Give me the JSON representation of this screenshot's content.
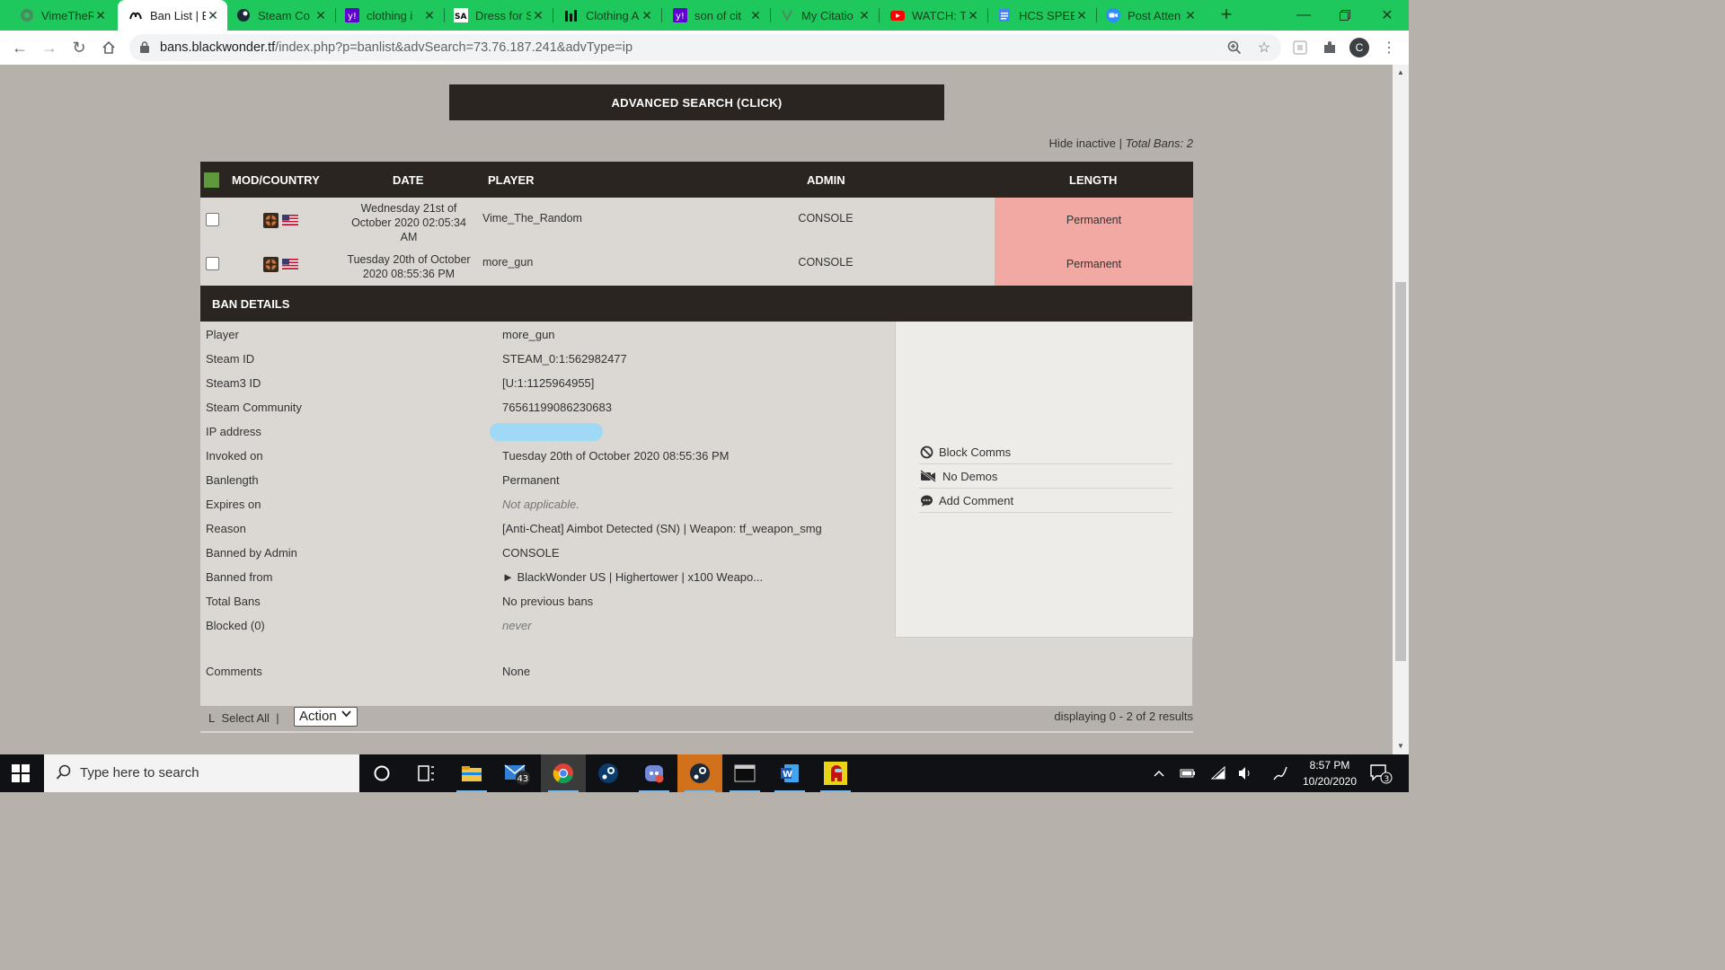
{
  "browser": {
    "tabs": [
      {
        "title": "VimeTheR",
        "active": false
      },
      {
        "title": "Ban List | E",
        "active": true
      },
      {
        "title": "Steam Co",
        "active": false
      },
      {
        "title": "clothing i",
        "active": false
      },
      {
        "title": "Dress for S",
        "active": false
      },
      {
        "title": "Clothing A",
        "active": false
      },
      {
        "title": "son of cit",
        "active": false
      },
      {
        "title": "My Citatio",
        "active": false
      },
      {
        "title": "WATCH: T",
        "active": false
      },
      {
        "title": "HCS SPEE",
        "active": false
      },
      {
        "title": "Post Atten",
        "active": false
      }
    ],
    "url_host": "bans.blackwonder.tf",
    "url_path": "/index.php?p=banlist&advSearch=73.76.187.241&advType=ip",
    "profile_initial": "C"
  },
  "page": {
    "advanced_search_label": "ADVANCED SEARCH (CLICK)",
    "hide_inactive": "Hide inactive",
    "total_bans": "Total Bans: 2",
    "columns": {
      "mod_country": "MOD/COUNTRY",
      "date": "DATE",
      "player": "PLAYER",
      "admin": "ADMIN",
      "length": "LENGTH"
    },
    "bans": [
      {
        "date_line1": "Wednesday 21st of",
        "date_line2": "October 2020 02:05:34",
        "date_line3": "AM",
        "player": "Vime_The_Random",
        "admin": "CONSOLE",
        "length": "Permanent"
      },
      {
        "date_line1": "Tuesday 20th of October",
        "date_line2": "2020 08:55:36 PM",
        "player": "more_gun",
        "admin": "CONSOLE",
        "length": "Permanent"
      }
    ],
    "details_title": "BAN DETAILS",
    "details": {
      "player": {
        "label": "Player",
        "value": "more_gun"
      },
      "steam_id": {
        "label": "Steam ID",
        "value": "STEAM_0:1:562982477"
      },
      "steam3_id": {
        "label": "Steam3 ID",
        "value": "[U:1:1125964955]"
      },
      "community": {
        "label": "Steam Community",
        "value": "76561199086230683"
      },
      "ip": {
        "label": "IP address"
      },
      "invoked": {
        "label": "Invoked on",
        "value": "Tuesday 20th of October 2020 08:55:36 PM"
      },
      "banlength": {
        "label": "Banlength",
        "value": "Permanent"
      },
      "expires": {
        "label": "Expires on",
        "value": "Not applicable."
      },
      "reason": {
        "label": "Reason",
        "value": "[Anti-Cheat] Aimbot Detected (SN) | Weapon: tf_weapon_smg"
      },
      "banned_by": {
        "label": "Banned by Admin",
        "value": "CONSOLE"
      },
      "banned_from": {
        "label": "Banned from",
        "value": "► BlackWonder US | Highertower | x100 Weapo..."
      },
      "total_bans": {
        "label": "Total Bans",
        "value": "No previous bans"
      },
      "blocked": {
        "label": "Blocked (0)",
        "value": "never"
      },
      "comments": {
        "label": "Comments",
        "value": "None"
      }
    },
    "side_actions": {
      "block_comms": "Block Comms",
      "no_demos": "No Demos",
      "add_comment": "Add Comment"
    },
    "select_all_prefix": "L",
    "select_all": "Select All",
    "select_sep": "|",
    "action_label": "Action",
    "results": "displaying 0 - 2 of 2 results"
  },
  "taskbar": {
    "search_placeholder": "Type here to search",
    "mail_badge": "43",
    "time": "8:57 PM",
    "date": "10/20/2020",
    "notification_count": "3"
  }
}
